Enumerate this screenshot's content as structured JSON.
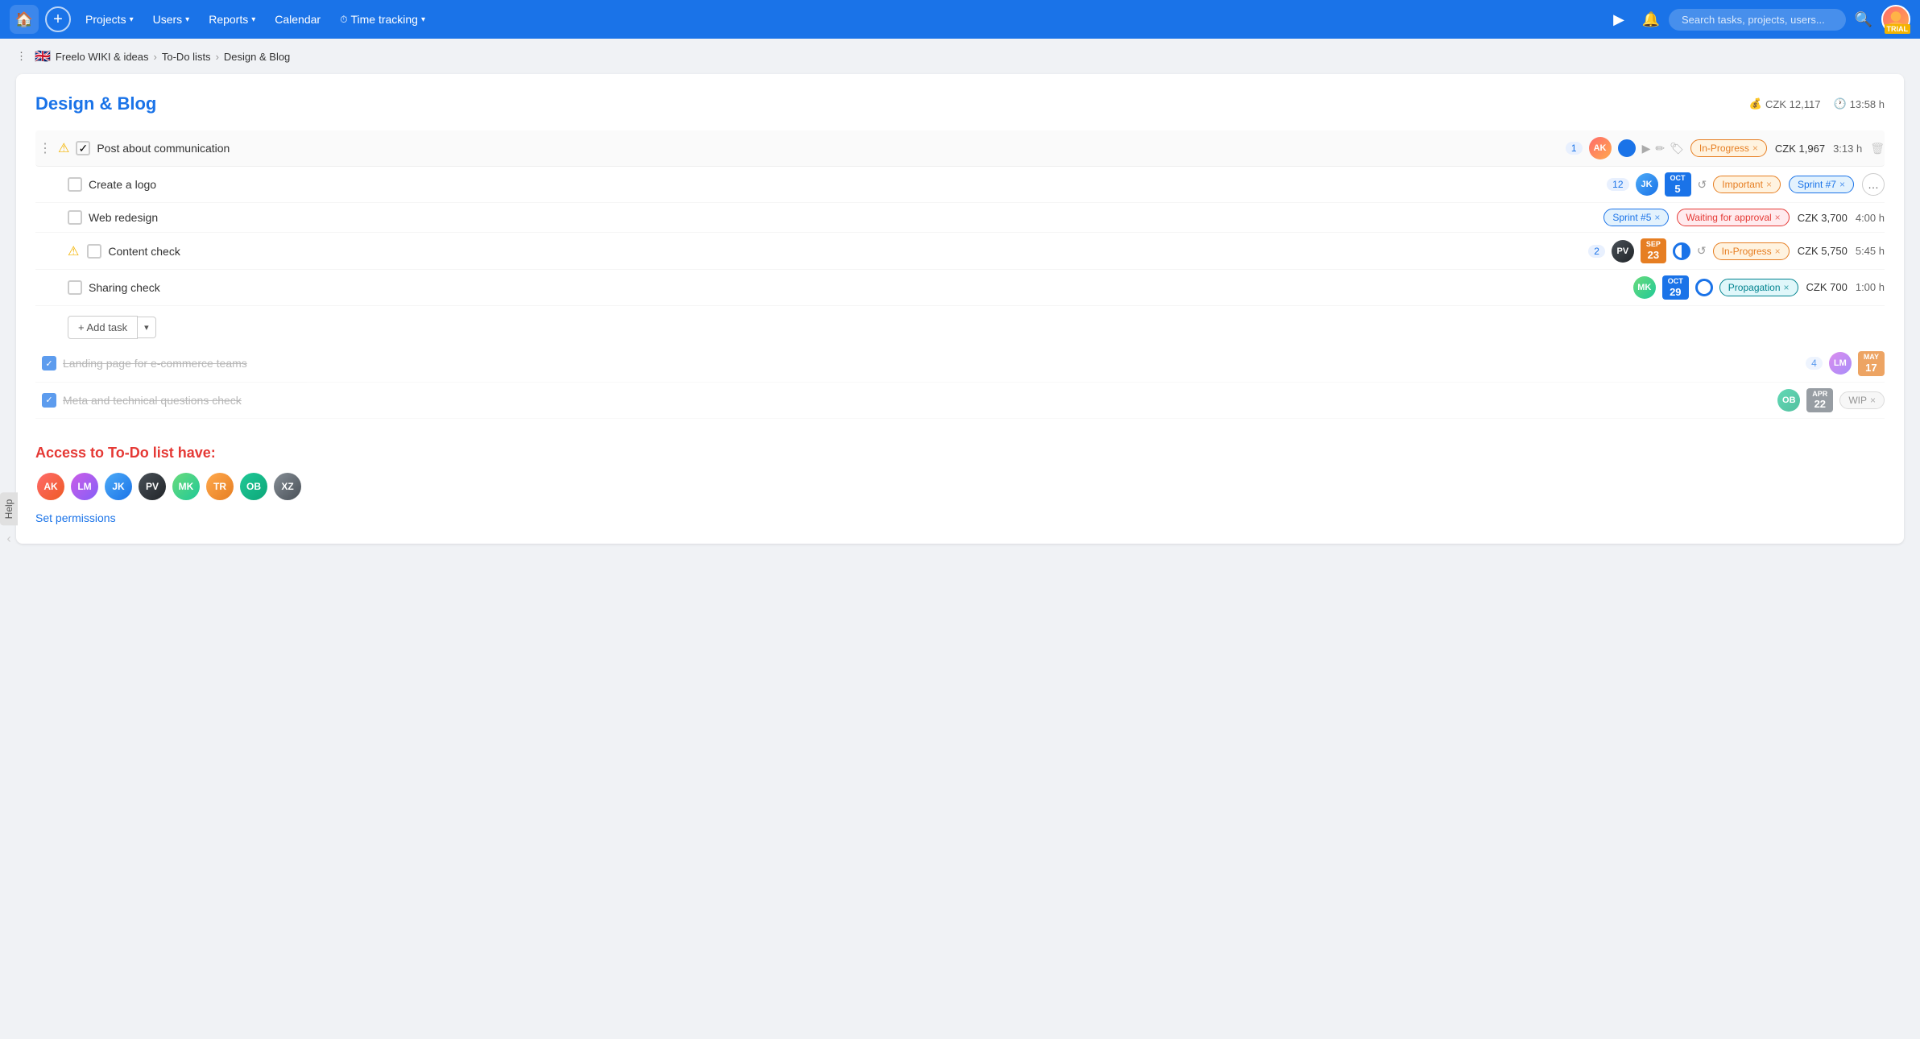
{
  "nav": {
    "home_icon": "🏠",
    "add_icon": "+",
    "items": [
      {
        "label": "Projects",
        "has_dropdown": true
      },
      {
        "label": "Users",
        "has_dropdown": true
      },
      {
        "label": "Reports",
        "has_dropdown": true
      },
      {
        "label": "Calendar",
        "has_dropdown": false
      },
      {
        "label": "Time tracking",
        "has_dropdown": true
      }
    ],
    "play_icon": "▶",
    "bell_icon": "🔔",
    "search_placeholder": "Search tasks, projects, users...",
    "trial_label": "TRIAL"
  },
  "breadcrumb": {
    "project": "Freelo WIKI & ideas",
    "list": "To-Do lists",
    "current": "Design & Blog",
    "flag": "🇬🇧"
  },
  "page": {
    "title": "Design & Blog",
    "total_price": "CZK 12,117",
    "total_time": "13:58 h"
  },
  "section": {
    "name": "Post about communication",
    "comment_count": "1",
    "price": "CZK 1,967",
    "time": "3:13 h",
    "tag": "In-Progress"
  },
  "tasks": [
    {
      "name": "Create a logo",
      "comment_count": "12",
      "date_month": "Oct",
      "date_day": "5",
      "date_color": "blue",
      "tags": [
        {
          "label": "Important",
          "type": "orange"
        },
        {
          "label": "Sprint #7",
          "type": "blue"
        }
      ],
      "has_more": true,
      "completed": false,
      "has_refresh": true,
      "avatar_type": "default"
    },
    {
      "name": "Web redesign",
      "comment_count": null,
      "date_month": null,
      "date_day": null,
      "tags": [
        {
          "label": "Sprint #5",
          "type": "blue"
        },
        {
          "label": "Waiting for approval",
          "type": "red"
        }
      ],
      "price": "CZK 3,700",
      "time": "4:00 h",
      "completed": false,
      "avatar_type": null
    },
    {
      "name": "Content check",
      "comment_count": "2",
      "date_month": "Sep",
      "date_day": "23",
      "date_color": "orange",
      "tags": [
        {
          "label": "In-Progress",
          "type": "orange-bordered"
        }
      ],
      "price": "CZK 5,750",
      "time": "5:45 h",
      "has_warning": true,
      "completed": false,
      "has_progress": true,
      "has_refresh": true,
      "avatar_type": "dark"
    },
    {
      "name": "Sharing check",
      "comment_count": null,
      "date_month": "Oct",
      "date_day": "29",
      "date_color": "blue",
      "tags": [
        {
          "label": "Propagation",
          "type": "teal"
        }
      ],
      "price": "CZK 700",
      "time": "1:00 h",
      "completed": false,
      "has_progress_empty": true,
      "avatar_type": "green"
    }
  ],
  "completed_tasks": [
    {
      "name": "Landing page for e-commerce teams",
      "comment_count": "4",
      "date_month": "May",
      "date_day": "17",
      "completed": true,
      "avatar_type": "purple"
    },
    {
      "name": "Meta and technical questions check",
      "comment_count": null,
      "date_month": "Apr",
      "date_day": "22",
      "tags": [
        {
          "label": "WIP",
          "type": "grey"
        }
      ],
      "completed": true,
      "avatar_type": "teal"
    }
  ],
  "add_task": {
    "label": "+ Add task",
    "dropdown_icon": "▾"
  },
  "access": {
    "title": "Access to To-Do list have:",
    "avatars": [
      {
        "type": "red",
        "initials": "AK"
      },
      {
        "type": "purple",
        "initials": "LM"
      },
      {
        "type": "blue",
        "initials": "JK"
      },
      {
        "type": "dark",
        "initials": "PV"
      },
      {
        "type": "green",
        "initials": "MK"
      },
      {
        "type": "orange",
        "initials": "TR"
      },
      {
        "type": "teal",
        "initials": "OB"
      },
      {
        "type": "grey2",
        "initials": "XZ"
      }
    ],
    "permissions_link": "Set permissions"
  }
}
